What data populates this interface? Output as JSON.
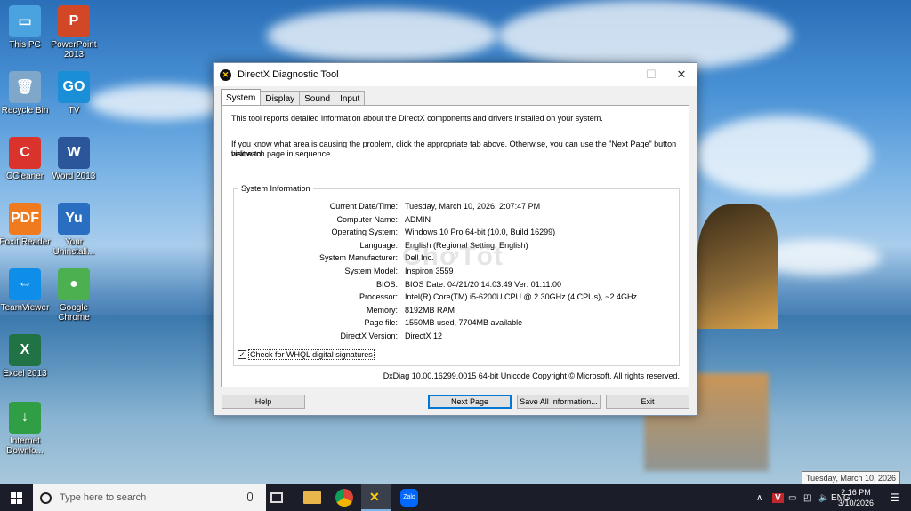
{
  "desktop": {
    "icons": [
      {
        "label": "This PC",
        "icon": "this-pc-icon",
        "color": "#4aa3df",
        "glyph": "▭"
      },
      {
        "label": "PowerPoint 2013",
        "icon": "powerpoint-icon",
        "color": "#d24726",
        "glyph": "P"
      },
      {
        "label": "Recycle Bin",
        "icon": "recycle-bin-icon",
        "color": "#7fa7c9",
        "glyph": "🗑"
      },
      {
        "label": "TV",
        "icon": "gotv-icon",
        "color": "#1a8fd8",
        "glyph": "GO"
      },
      {
        "label": "CCleaner",
        "icon": "ccleaner-icon",
        "color": "#d9332b",
        "glyph": "C"
      },
      {
        "label": "Word 2013",
        "icon": "word-icon",
        "color": "#2b579a",
        "glyph": "W"
      },
      {
        "label": "Foxit Reader",
        "icon": "foxit-icon",
        "color": "#f07a1e",
        "glyph": "PDF"
      },
      {
        "label": "Your Uninstall...",
        "icon": "your-uninstaller-icon",
        "color": "#2a6ec2",
        "glyph": "Yu"
      },
      {
        "label": "TeamViewer",
        "icon": "teamviewer-icon",
        "color": "#0e8ee9",
        "glyph": "⇔"
      },
      {
        "label": "Google Chrome",
        "icon": "chrome-icon",
        "color": "#4caf50",
        "glyph": "●"
      },
      {
        "label": "Excel 2013",
        "icon": "excel-icon",
        "color": "#217346",
        "glyph": "X"
      },
      {
        "label": "Internet Downlo...",
        "icon": "idm-icon",
        "color": "#2f9e44",
        "glyph": "↓"
      }
    ]
  },
  "dialog": {
    "title": "DirectX Diagnostic Tool",
    "tabs": [
      "System",
      "Display",
      "Sound",
      "Input"
    ],
    "active_tab": "System",
    "intro1": "This tool reports detailed information about the DirectX components and drivers installed on your system.",
    "intro2a": "If you know what area is causing the problem, click the appropriate tab above.  Otherwise, you can use the \"Next Page\" button below to",
    "intro2b": "visit each page in sequence.",
    "group_title": "System Information",
    "rows": [
      {
        "key": "Current Date/Time:",
        "value": "Tuesday, March 10, 2026, 2:07:47 PM"
      },
      {
        "key": "Computer Name:",
        "value": "ADMIN"
      },
      {
        "key": "Operating System:",
        "value": "Windows 10 Pro 64-bit (10.0, Build 16299)"
      },
      {
        "key": "Language:",
        "value": "English (Regional Setting: English)"
      },
      {
        "key": "System Manufacturer:",
        "value": "Dell Inc."
      },
      {
        "key": "System Model:",
        "value": "Inspiron 3559"
      },
      {
        "key": "BIOS:",
        "value": "BIOS Date: 04/21/20 14:03:49 Ver: 01.11.00"
      },
      {
        "key": "Processor:",
        "value": "Intel(R) Core(TM) i5-6200U CPU @ 2.30GHz (4 CPUs), ~2.4GHz"
      },
      {
        "key": "Memory:",
        "value": "8192MB RAM"
      },
      {
        "key": "Page file:",
        "value": "1550MB used, 7704MB available"
      },
      {
        "key": "DirectX Version:",
        "value": "DirectX 12"
      }
    ],
    "whql_label": "Check for WHQL digital signatures",
    "whql_checked": true,
    "footer": "DxDiag 10.00.16299.0015 64-bit Unicode  Copyright © Microsoft. All rights reserved.",
    "buttons": {
      "help": "Help",
      "next_page": "Next Page",
      "save_all": "Save All Information...",
      "exit": "Exit"
    }
  },
  "watermark": "ChợTốt",
  "taskbar": {
    "search_placeholder": "Type here to search",
    "clock_time": "2:16 PM",
    "clock_date": "3/10/2026",
    "tooltip": "Tuesday, March 10, 2026",
    "tray_lang": "ENG"
  }
}
